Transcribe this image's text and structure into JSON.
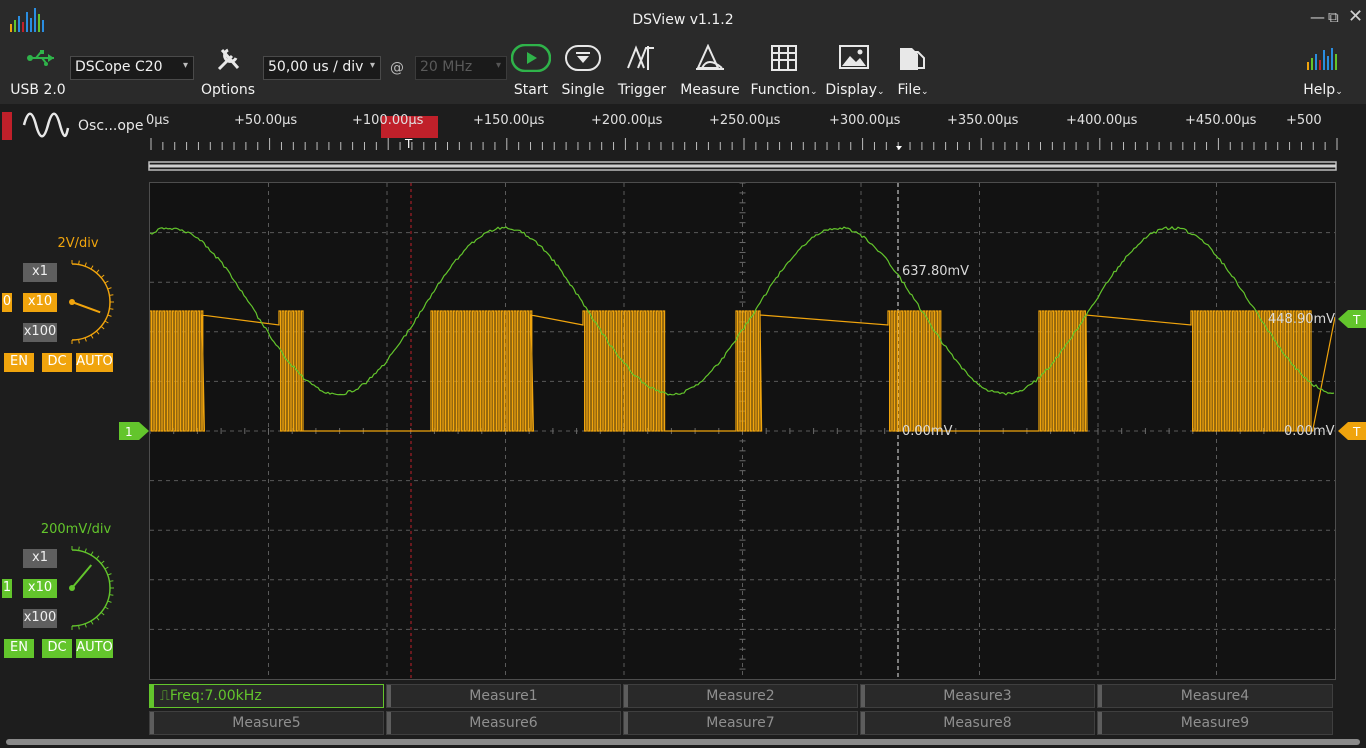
{
  "window": {
    "title": "DSView v1.1.2"
  },
  "toolbar": {
    "usb_label": "USB 2.0",
    "device_selected": "DSCope C20",
    "options_label": "Options",
    "timebase_selected": "50,00 us / div",
    "at_symbol": "@",
    "samplerate_selected": "20 MHz",
    "start_label": "Start",
    "single_label": "Single",
    "trigger_label": "Trigger",
    "measure_label": "Measure",
    "function_label": "Function",
    "display_label": "Display",
    "file_label": "File",
    "help_label": "Help"
  },
  "mode": {
    "label": "Osc...ope"
  },
  "timeline": {
    "ticks": [
      "0µs",
      "+50.00µs",
      "+100.00µs",
      "+150.00µs",
      "+200.00µs",
      "+250.00µs",
      "+300.00µs",
      "+350.00µs",
      "+400.00µs",
      "+450.00µs",
      "+500"
    ],
    "trigger_marker": "T"
  },
  "channels": [
    {
      "id": "0",
      "vdiv": "2V/div",
      "color": "#f0a40d",
      "probe_options": [
        "x1",
        "x10",
        "x100"
      ],
      "probe_selected": "x10",
      "buttons": [
        "EN",
        "DC",
        "AUTO"
      ],
      "zero_marker": "T"
    },
    {
      "id": "1",
      "vdiv": "200mV/div",
      "color": "#63c52c",
      "probe_options": [
        "x1",
        "x10",
        "x100"
      ],
      "probe_selected": "x10",
      "buttons": [
        "EN",
        "DC",
        "AUTO"
      ],
      "marker_label": "1"
    }
  ],
  "cursor_labels": {
    "green_peak": "637.80mV",
    "yellow_level": "448.90mV",
    "zero_a": "0.00mV",
    "zero_b": "0.00mV"
  },
  "measures": {
    "active": "Freq:7.00kHz",
    "slots": [
      "Measure1",
      "Measure2",
      "Measure3",
      "Measure4",
      "Measure5",
      "Measure6",
      "Measure7",
      "Measure8",
      "Measure9"
    ]
  },
  "colors": {
    "yellow_channel": "#f0a40d",
    "green_channel": "#63c52c",
    "trigger_red": "#c0202a",
    "start_green": "#2fb34a"
  }
}
